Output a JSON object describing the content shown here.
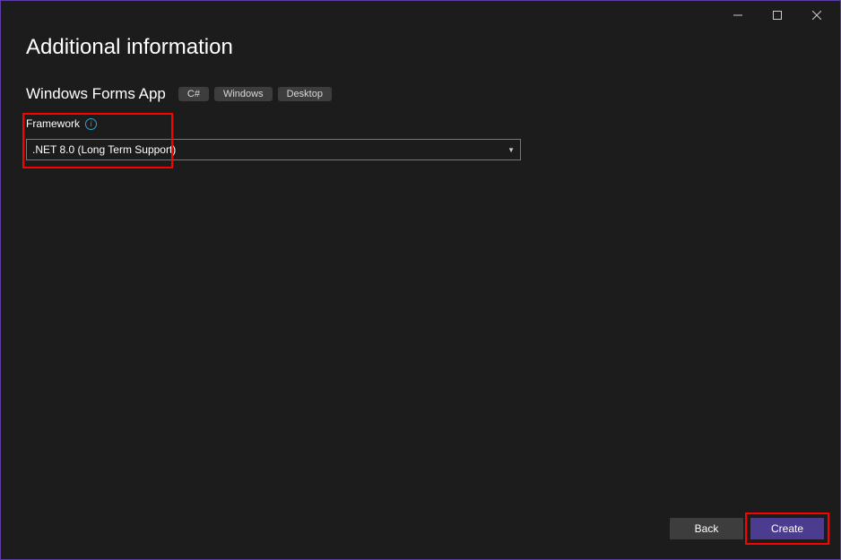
{
  "titlebar": {
    "minimize": "—",
    "maximize": "□",
    "close": "✕"
  },
  "page": {
    "title": "Additional information",
    "template_name": "Windows Forms App"
  },
  "tags": [
    "C#",
    "Windows",
    "Desktop"
  ],
  "framework": {
    "label": "Framework",
    "info_symbol": "i",
    "selected": ".NET 8.0 (Long Term Support)"
  },
  "footer": {
    "back": "Back",
    "create": "Create"
  }
}
